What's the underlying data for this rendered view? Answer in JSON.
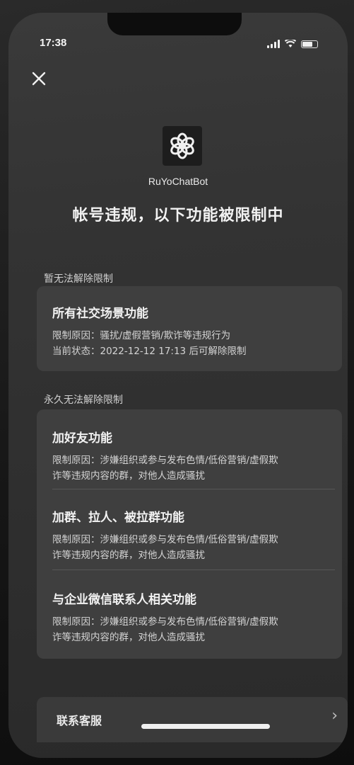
{
  "status_bar": {
    "time": "17:38"
  },
  "app": {
    "name": "RuYoChatBot"
  },
  "headline": "帐号违规，以下功能被限制中",
  "temporary": {
    "section_title": "暂无法解除限制",
    "items": [
      {
        "title": "所有社交场景功能",
        "reason": "限制原因：骚扰/虚假营销/欺诈等违规行为",
        "state": "当前状态：2022-12-12 17:13 后可解除限制"
      }
    ]
  },
  "permanent": {
    "section_title": "永久无法解除限制",
    "items": [
      {
        "title": "加好友功能",
        "reason_line1": "限制原因：涉嫌组织或参与发布色情/低俗营销/虚假欺",
        "reason_line2": "诈等违规内容的群，对他人造成骚扰"
      },
      {
        "title": "加群、拉人、被拉群功能",
        "reason_line1": "限制原因：涉嫌组织或参与发布色情/低俗营销/虚假欺",
        "reason_line2": "诈等违规内容的群，对他人造成骚扰"
      },
      {
        "title": "与企业微信联系人相关功能",
        "reason_line1": "限制原因：涉嫌组织或参与发布色情/低俗营销/虚假欺",
        "reason_line2": "诈等违规内容的群，对他人造成骚扰"
      }
    ]
  },
  "contact": {
    "label": "联系客服",
    "arrow": "›"
  }
}
